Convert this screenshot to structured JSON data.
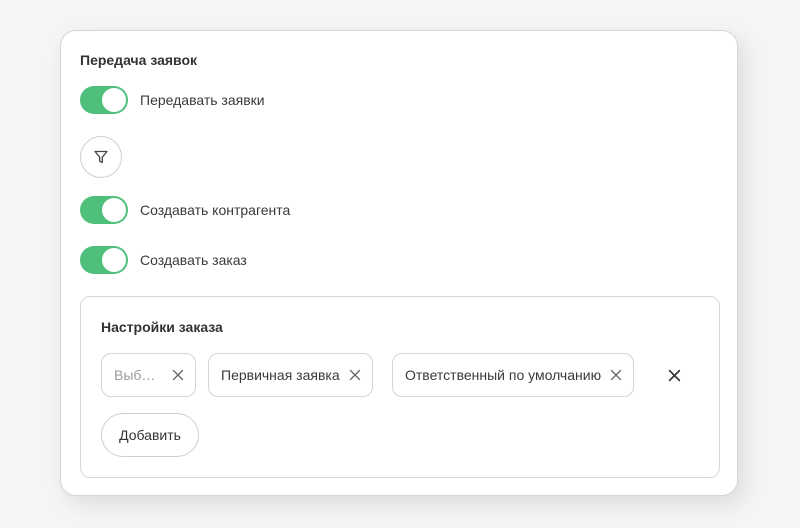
{
  "section": {
    "title": "Передача заявок"
  },
  "toggles": [
    {
      "label": "Передавать заявки",
      "on": true
    },
    {
      "label": "Создавать контрагента",
      "on": true
    },
    {
      "label": "Создавать заказ",
      "on": true
    }
  ],
  "filter": {
    "icon": "filter-icon"
  },
  "order_settings": {
    "title": "Настройки заказа",
    "chips": [
      {
        "label": "Выбо…",
        "placeholder": true
      },
      {
        "label": "Первичная заявка",
        "placeholder": false
      },
      {
        "label": "Ответственный по умолчанию",
        "placeholder": false
      }
    ],
    "clear_icon": "close-icon",
    "add_label": "Добавить"
  },
  "colors": {
    "accent": "#4fbf7c",
    "border": "#d6d6d6",
    "background": "#f5f5f5"
  }
}
